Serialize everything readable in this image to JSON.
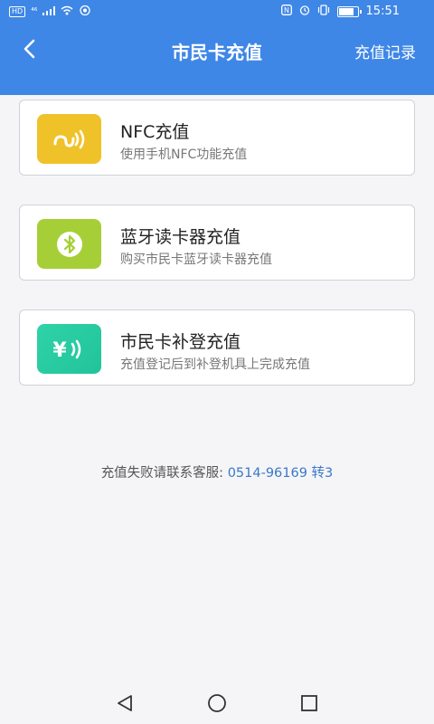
{
  "status_bar": {
    "left_badge": "HD",
    "signal_prefix": "⁴⁶",
    "time": "15:51"
  },
  "header": {
    "title": "市民卡充值",
    "action": "充值记录"
  },
  "options": [
    {
      "title": "NFC充值",
      "subtitle": "使用手机NFC功能充值",
      "icon": "nfc-icon",
      "color": "#f0c22a"
    },
    {
      "title": "蓝牙读卡器充值",
      "subtitle": "购买市民卡蓝牙读卡器充值",
      "icon": "bluetooth-icon",
      "color": "#a6cf37"
    },
    {
      "title": "市民卡补登充值",
      "subtitle": "充值登记后到补登机具上完成充值",
      "icon": "yuan-wave-icon",
      "color": "#2fd3a8"
    }
  ],
  "service": {
    "label": "充值失败请联系客服:",
    "phone": "0514-96169 转3"
  },
  "colors": {
    "header_bg": "#3f87e6",
    "link": "#3a78c8"
  }
}
